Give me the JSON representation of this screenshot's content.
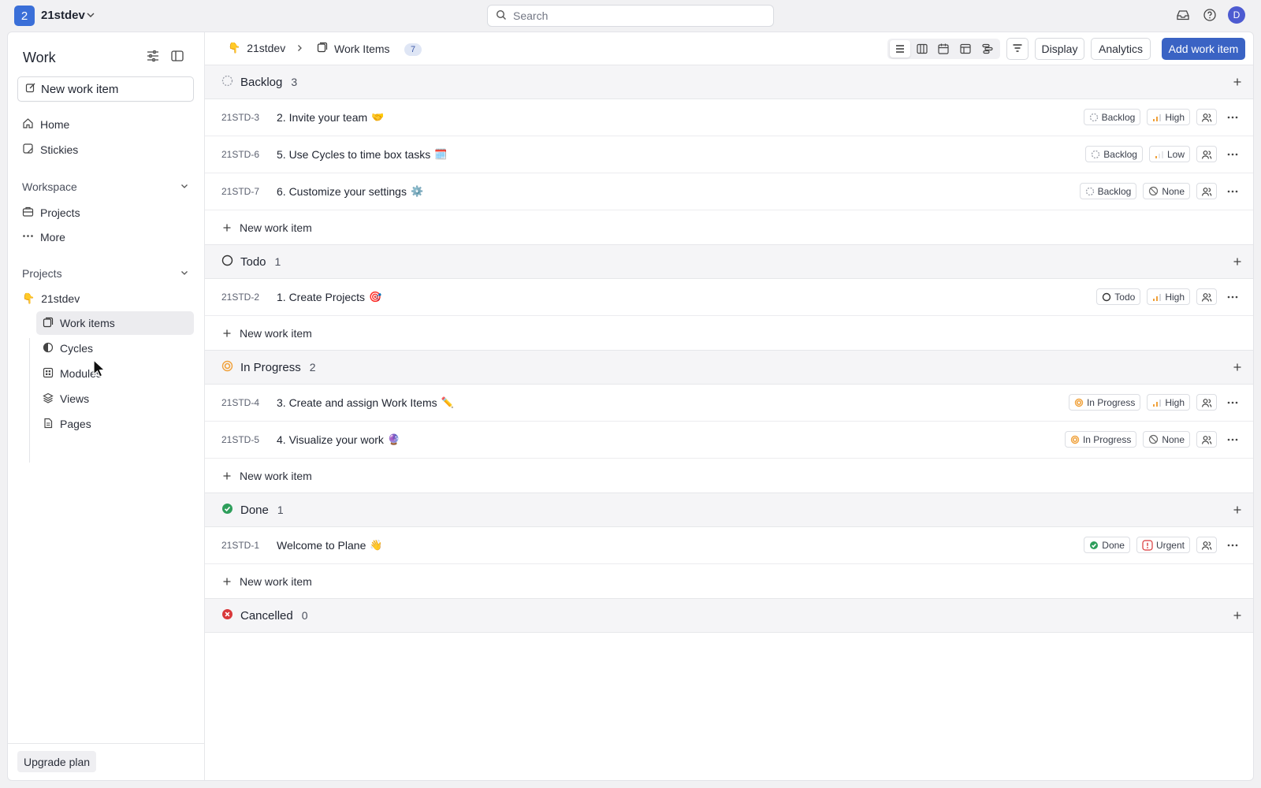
{
  "topbar": {
    "workspace_initial": "2",
    "workspace_name": "21stdev",
    "search_placeholder": "Search",
    "avatar_initial": "D"
  },
  "sidebar": {
    "title": "Work",
    "new_item_label": "New work item",
    "nav": [
      {
        "label": "Home",
        "icon": "home-icon"
      },
      {
        "label": "Stickies",
        "icon": "sticky-icon"
      }
    ],
    "workspace_section": "Workspace",
    "workspace_items": [
      {
        "label": "Projects",
        "icon": "briefcase-icon"
      },
      {
        "label": "More",
        "icon": "more-icon"
      }
    ],
    "projects_section": "Projects",
    "project": {
      "emoji": "👇",
      "name": "21stdev"
    },
    "project_items": [
      {
        "label": "Work items",
        "icon": "work-items-icon",
        "active": true
      },
      {
        "label": "Cycles",
        "icon": "cycles-icon"
      },
      {
        "label": "Modules",
        "icon": "modules-icon"
      },
      {
        "label": "Views",
        "icon": "layers-icon"
      },
      {
        "label": "Pages",
        "icon": "page-icon"
      }
    ],
    "upgrade_label": "Upgrade plan"
  },
  "header": {
    "project_emoji": "👇",
    "project_name": "21stdev",
    "page_name": "Work Items",
    "count": "7",
    "display_label": "Display",
    "analytics_label": "Analytics",
    "add_label": "Add work item"
  },
  "new_row_label": "New work item",
  "groups": [
    {
      "name": "Backlog",
      "count": "3",
      "icon": "backlog",
      "items": [
        {
          "id": "21STD-3",
          "title": "2. Invite your team",
          "emoji": "🤝",
          "state": "Backlog",
          "state_icon": "backlog",
          "priority": "High",
          "priority_icon": "high"
        },
        {
          "id": "21STD-6",
          "title": "5. Use Cycles to time box tasks",
          "emoji": "🗓️",
          "state": "Backlog",
          "state_icon": "backlog",
          "priority": "Low",
          "priority_icon": "low"
        },
        {
          "id": "21STD-7",
          "title": "6. Customize your settings",
          "emoji": "⚙️",
          "state": "Backlog",
          "state_icon": "backlog",
          "priority": "None",
          "priority_icon": "none"
        }
      ]
    },
    {
      "name": "Todo",
      "count": "1",
      "icon": "todo",
      "items": [
        {
          "id": "21STD-2",
          "title": "1. Create Projects",
          "emoji": "🎯",
          "state": "Todo",
          "state_icon": "todo",
          "priority": "High",
          "priority_icon": "high"
        }
      ]
    },
    {
      "name": "In Progress",
      "count": "2",
      "icon": "progress",
      "items": [
        {
          "id": "21STD-4",
          "title": "3. Create and assign Work Items",
          "emoji": "✏️",
          "state": "In Progress",
          "state_icon": "progress",
          "priority": "High",
          "priority_icon": "high"
        },
        {
          "id": "21STD-5",
          "title": "4. Visualize your work",
          "emoji": "🔮",
          "state": "In Progress",
          "state_icon": "progress",
          "priority": "None",
          "priority_icon": "none"
        }
      ]
    },
    {
      "name": "Done",
      "count": "1",
      "icon": "done",
      "items": [
        {
          "id": "21STD-1",
          "title": "Welcome to Plane",
          "emoji": "👋",
          "state": "Done",
          "state_icon": "done",
          "priority": "Urgent",
          "priority_icon": "urgent"
        }
      ]
    },
    {
      "name": "Cancelled",
      "count": "0",
      "icon": "cancelled",
      "items": []
    }
  ],
  "colors": {
    "accent": "#3a63c4",
    "progress": "#f0a13a",
    "done": "#2e9e5b",
    "cancelled": "#d9383a",
    "urgent": "#d9383a",
    "priority_bar": "#f0a13a"
  }
}
